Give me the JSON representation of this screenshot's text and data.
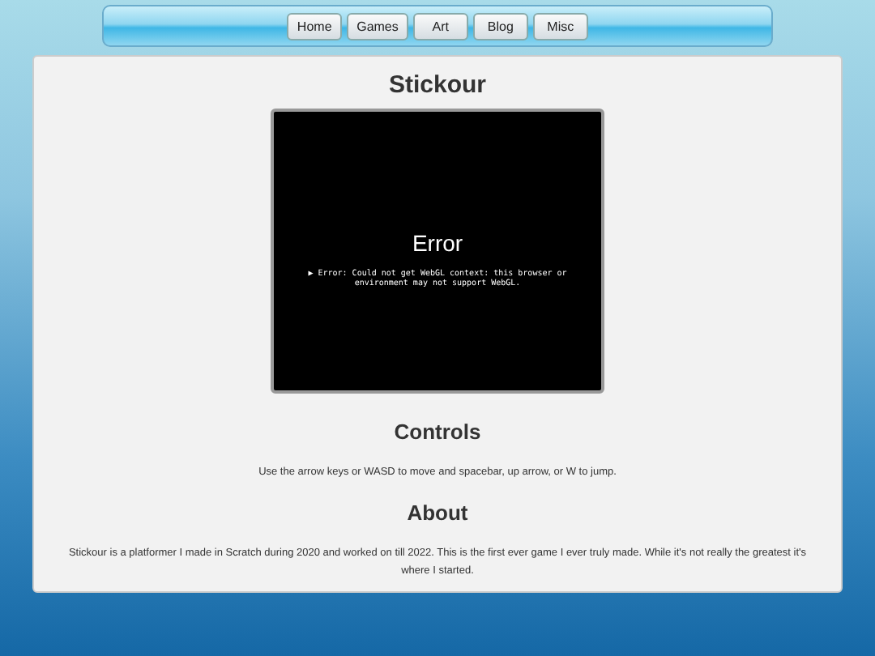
{
  "nav": [
    {
      "label": "Home"
    },
    {
      "label": "Games"
    },
    {
      "label": "Art"
    },
    {
      "label": "Blog"
    },
    {
      "label": "Misc"
    }
  ],
  "title": "Stickour",
  "game": {
    "error_title": "Error",
    "error_message": "▶ Error: Could not get WebGL context: this browser or environment may not support WebGL."
  },
  "sections": [
    {
      "heading": "Controls",
      "text": "Use the arrow keys or WASD to move and spacebar, up arrow, or W to jump."
    },
    {
      "heading": "About",
      "text": "Stickour is a platformer I made in Scratch during 2020 and worked on till 2022. This is the first ever game I ever truly made. While it's not really the greatest it's where I started."
    }
  ]
}
